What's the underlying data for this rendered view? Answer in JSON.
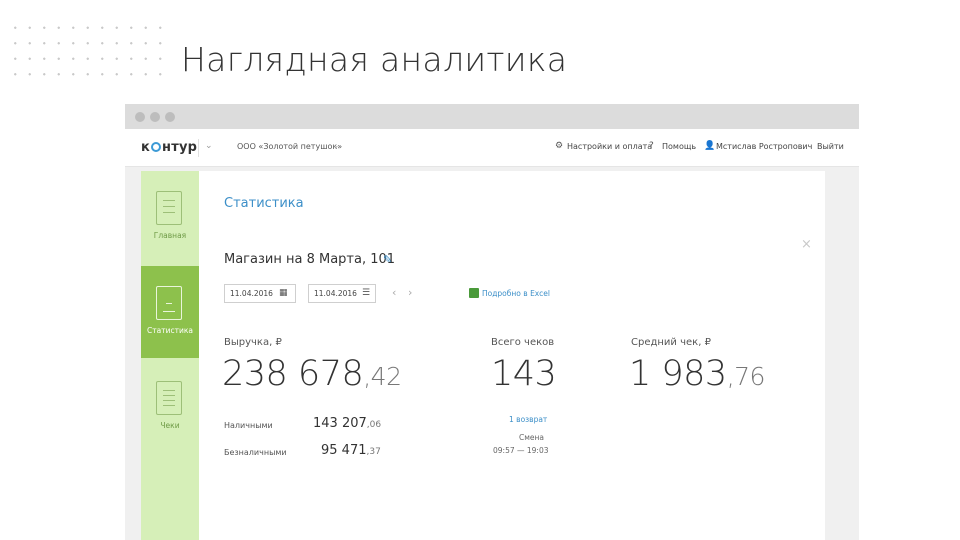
{
  "slide": {
    "title": "Наглядная аналитика"
  },
  "topbar": {
    "logo_left": "к",
    "logo_right": "нтур",
    "org_name": "ООО «Золотой петушок»",
    "settings_label": "Настройки и оплата",
    "help_label": "Помощь",
    "user_name": "Мстислав Ростропович",
    "logout_label": "Выйти"
  },
  "sidebar": {
    "items": [
      {
        "label": "Главная",
        "icon": "home-doc-icon",
        "active": false
      },
      {
        "label": "Статистика",
        "icon": "stats-chart-icon",
        "active": true
      },
      {
        "label": "Чеки",
        "icon": "receipt-icon",
        "active": false
      }
    ]
  },
  "main": {
    "page_title": "Статистика",
    "close_glyph": "×",
    "store_name": "Магазин на 8 Марта, 101",
    "date_from": "11.04.2016",
    "date_to": "11.04.2016",
    "excel_link": "Подробно в Excel",
    "revenue": {
      "label": "Выручка, ₽",
      "integer": "238 678",
      "cents": ",42"
    },
    "checks": {
      "label": "Всего чеков",
      "value": "143"
    },
    "avg": {
      "label": "Средний чек, ₽",
      "integer": "1 983",
      "cents": ",76"
    },
    "cash": {
      "label": "Наличными",
      "integer": "143 207",
      "cents": ",06"
    },
    "cashless": {
      "label": "Безналичными",
      "integer": "95 471",
      "cents": ",37"
    },
    "returns_link": "1 возврат",
    "shift_label": "Смена",
    "shift_time": "09:57 — 19:03"
  },
  "colors": {
    "accent_blue": "#3c8fc8",
    "sidebar_bg": "#d6efb8",
    "sidebar_active": "#8dc14c"
  }
}
